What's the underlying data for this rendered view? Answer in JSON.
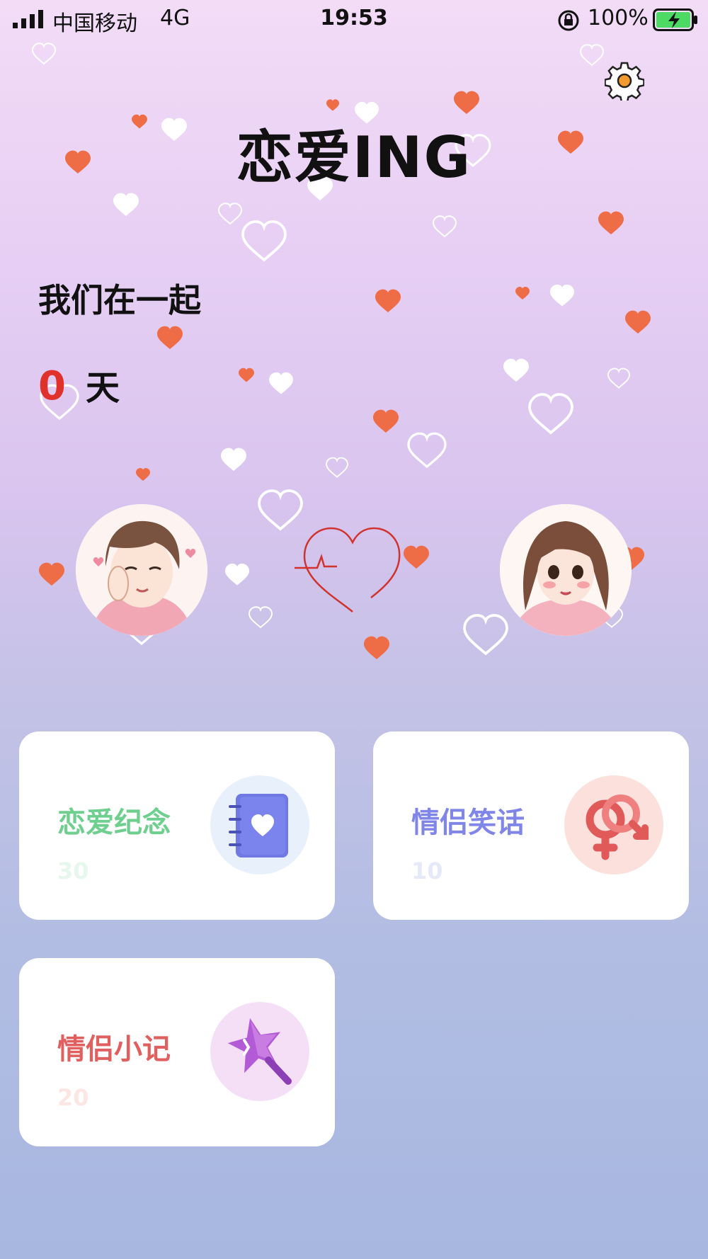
{
  "status_bar": {
    "carrier": "中国移动",
    "network": "4G",
    "time": "19:53",
    "battery": "100%"
  },
  "header": {
    "title": "恋爱ING",
    "settings_icon": "gear-icon"
  },
  "together": {
    "label": "我们在一起",
    "days": "0",
    "unit": "天"
  },
  "cards": [
    {
      "label": "恋爱纪念",
      "count": "30",
      "color": "#6fcf8f",
      "count_color": "#e6f8ee",
      "icon": "diary-heart-icon",
      "circle_color": "#e8f0fc"
    },
    {
      "label": "情侣笑话",
      "count": "10",
      "color": "#7f86e8",
      "count_color": "#e6eaf8",
      "icon": "gender-symbols-icon",
      "circle_color": "#fbe0dc"
    },
    {
      "label": "情侣小记",
      "count": "20",
      "color": "#e06060",
      "count_color": "#fbe6e4",
      "icon": "star-wand-icon",
      "circle_color": "#f4dff7"
    }
  ],
  "colors": {
    "accent_red": "#e0322c",
    "heart_orange": "#ee6d47"
  }
}
